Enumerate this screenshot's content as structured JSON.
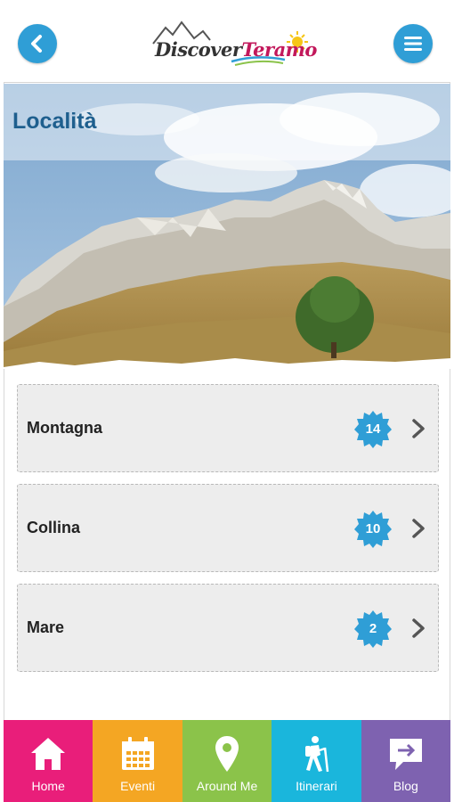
{
  "header": {
    "logo_word1": "Discover",
    "logo_word2": "Teramo"
  },
  "hero": {
    "title": "Località"
  },
  "categories": [
    {
      "label": "Montagna",
      "count": "14"
    },
    {
      "label": "Collina",
      "count": "10"
    },
    {
      "label": "Mare",
      "count": "2"
    }
  ],
  "nav": {
    "items": [
      {
        "label": "Home",
        "icon": "home-icon",
        "color": "#e91e7a"
      },
      {
        "label": "Eventi",
        "icon": "calendar-icon",
        "color": "#f4a623"
      },
      {
        "label": "Around Me",
        "icon": "location-pin-icon",
        "color": "#8bc34a"
      },
      {
        "label": "Itinerari",
        "icon": "hiker-icon",
        "color": "#1ab6dc"
      },
      {
        "label": "Blog",
        "icon": "chat-arrow-icon",
        "color": "#7e62b0"
      }
    ]
  },
  "colors": {
    "accent": "#2f9ed6",
    "title": "#1e5f8e"
  }
}
